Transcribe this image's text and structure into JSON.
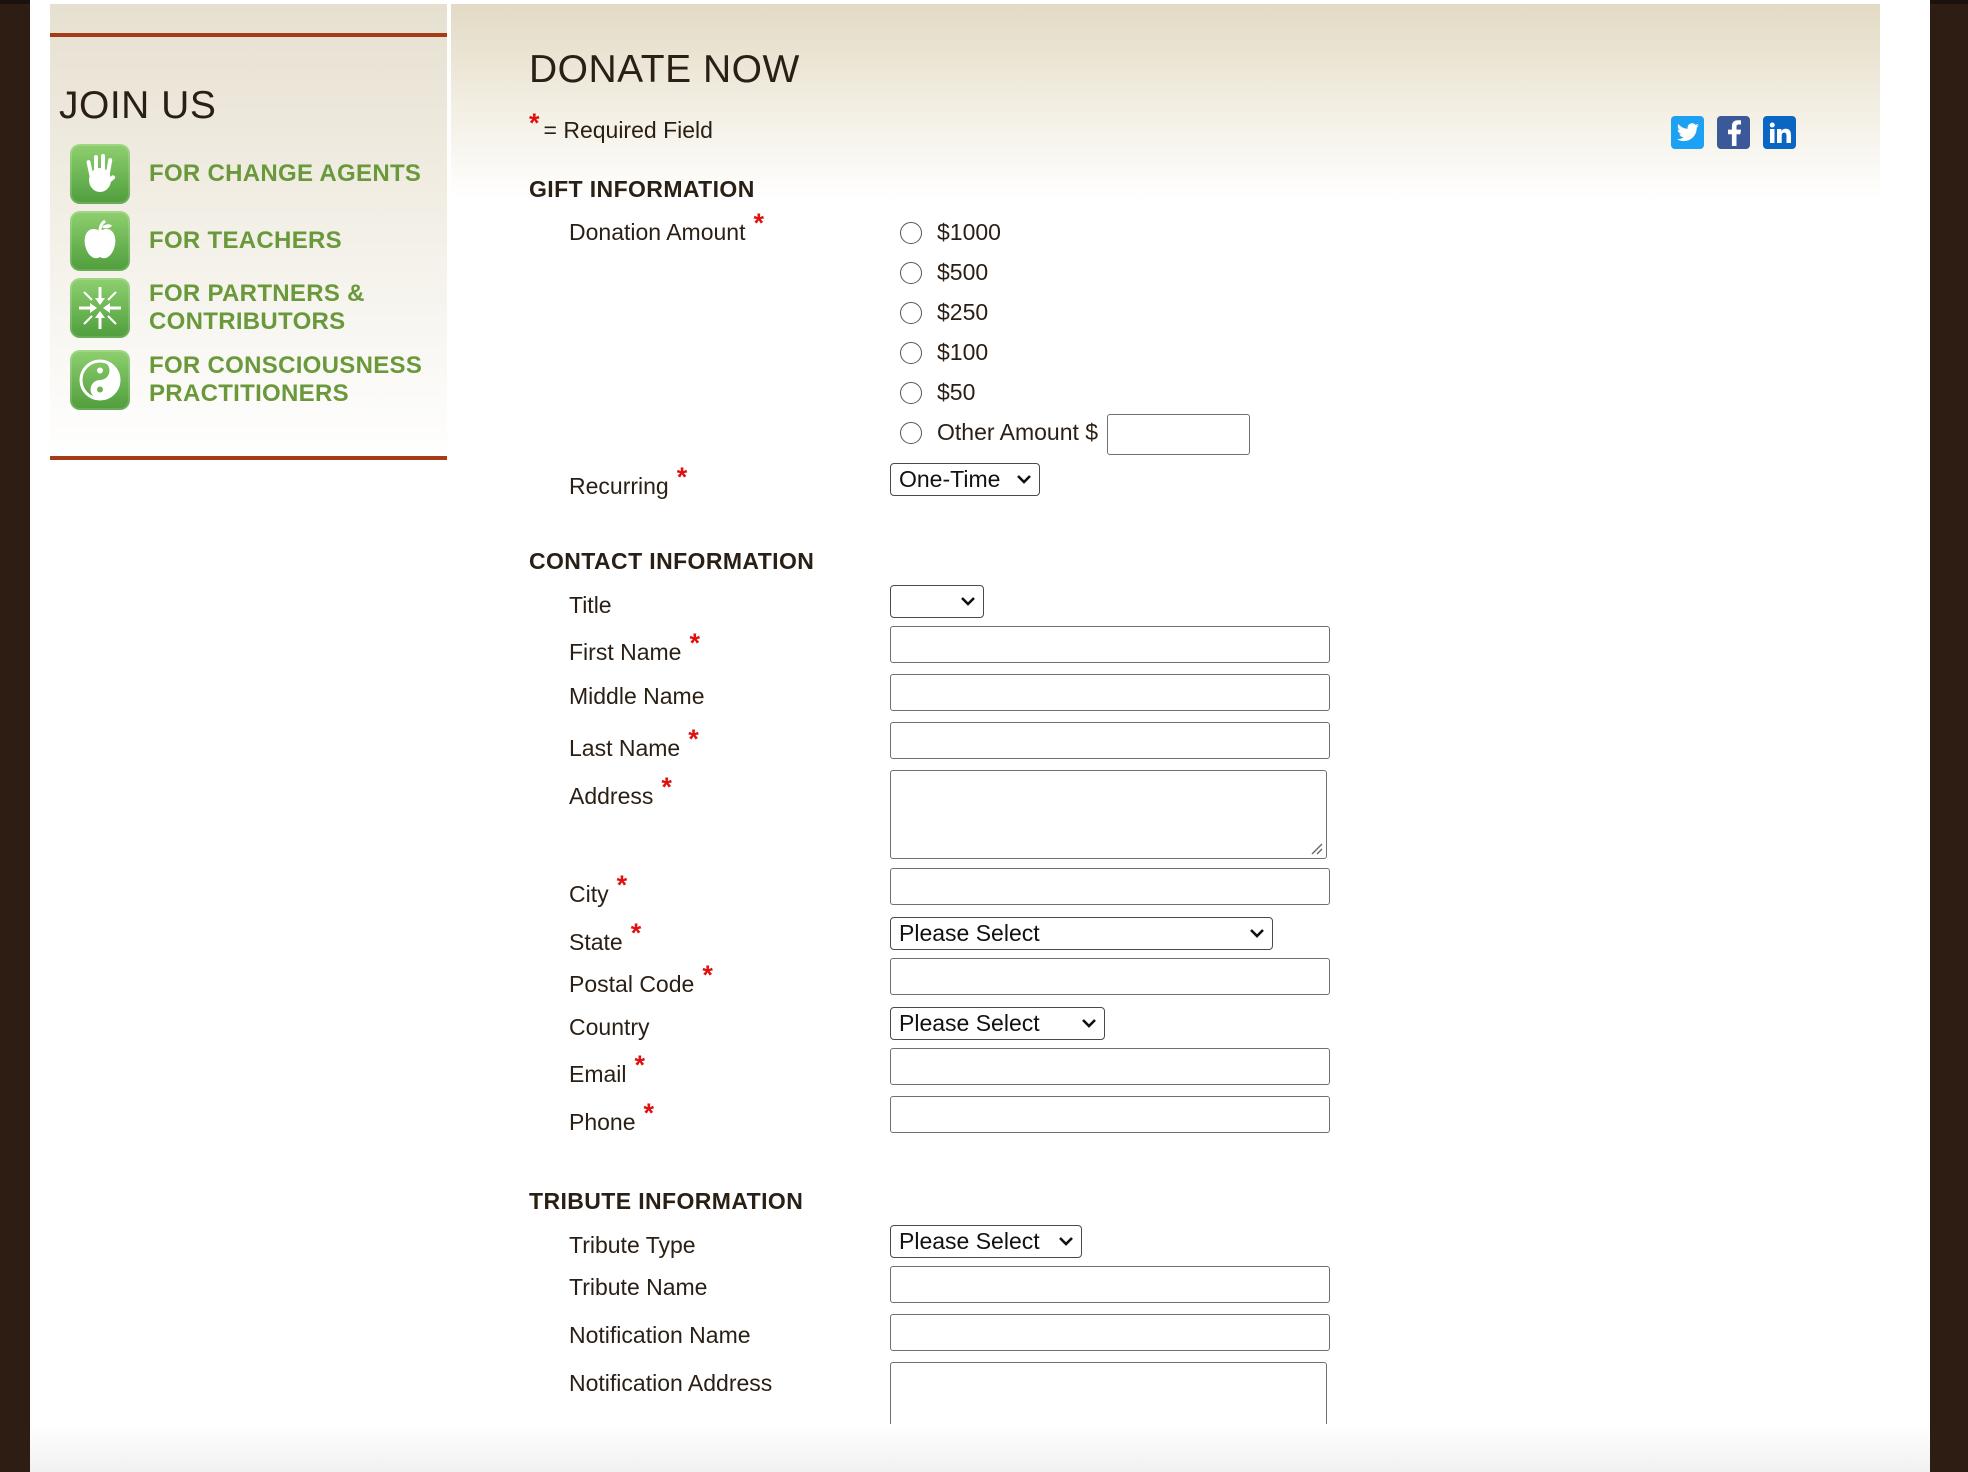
{
  "sidebar": {
    "title": "JOIN US",
    "items": [
      {
        "line1": "FOR CHANGE AGENTS",
        "line2": "",
        "icon": "hand-icon"
      },
      {
        "line1": "FOR TEACHERS",
        "line2": "",
        "icon": "apple-icon"
      },
      {
        "line1": "FOR PARTNERS &",
        "line2": "CONTRIBUTORS",
        "icon": "converging-arrows-icon"
      },
      {
        "line1": "FOR CONSCIOUSNESS",
        "line2": "PRACTITIONERS",
        "icon": "yin-yang-icon"
      }
    ]
  },
  "page": {
    "title": "DONATE NOW",
    "required_marker": "*",
    "required_note": "= Required Field"
  },
  "social": [
    "twitter-icon",
    "facebook-icon",
    "linkedin-icon"
  ],
  "gift": {
    "heading": "GIFT INFORMATION",
    "donation_label": "Donation Amount",
    "amounts": [
      "$1000",
      "$500",
      "$250",
      "$100",
      "$50",
      "Other Amount $"
    ],
    "recurring_label": "Recurring",
    "recurring_value": "One-Time"
  },
  "contact": {
    "heading": "CONTACT INFORMATION",
    "title_label": "Title",
    "title_value": "",
    "first_name_label": "First Name",
    "middle_name_label": "Middle Name",
    "last_name_label": "Last Name",
    "address_label": "Address",
    "city_label": "City",
    "state_label": "State",
    "state_value": "Please Select",
    "postal_label": "Postal Code",
    "country_label": "Country",
    "country_value": "Please Select",
    "email_label": "Email",
    "phone_label": "Phone"
  },
  "tribute": {
    "heading": "TRIBUTE INFORMATION",
    "type_label": "Tribute Type",
    "type_value": "Please Select",
    "name_label": "Tribute Name",
    "notification_name_label": "Notification Name",
    "notification_address_label": "Notification Address"
  },
  "colors": {
    "accent_rule": "#a53b17",
    "link_green": "#69993a",
    "required_red": "#e01010",
    "outer_background": "#2e1d12"
  }
}
